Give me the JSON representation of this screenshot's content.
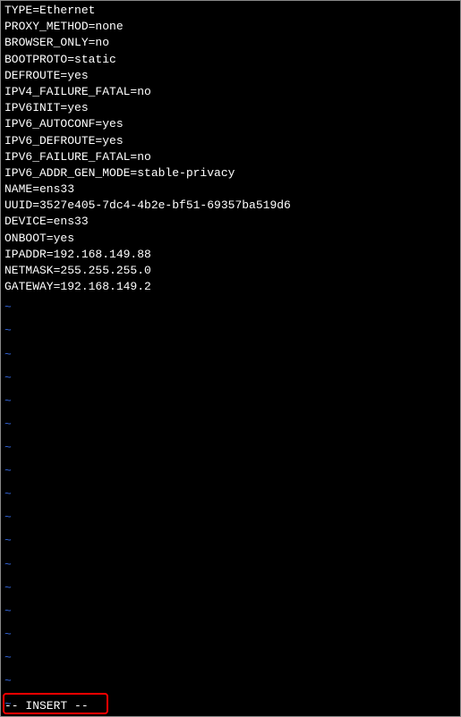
{
  "config_lines": [
    "TYPE=Ethernet",
    "PROXY_METHOD=none",
    "BROWSER_ONLY=no",
    "BOOTPROTO=static",
    "DEFROUTE=yes",
    "IPV4_FAILURE_FATAL=no",
    "IPV6INIT=yes",
    "IPV6_AUTOCONF=yes",
    "IPV6_DEFROUTE=yes",
    "IPV6_FAILURE_FATAL=no",
    "IPV6_ADDR_GEN_MODE=stable-privacy",
    "NAME=ens33",
    "UUID=3527e405-7dc4-4b2e-bf51-69357ba519d6",
    "DEVICE=ens33",
    "ONBOOT=yes",
    "IPADDR=192.168.149.88",
    "NETMASK=255.255.255.0",
    "GATEWAY=192.168.149.2"
  ],
  "tilde_char": "~",
  "tilde_count": 18,
  "status_text": "-- INSERT --"
}
